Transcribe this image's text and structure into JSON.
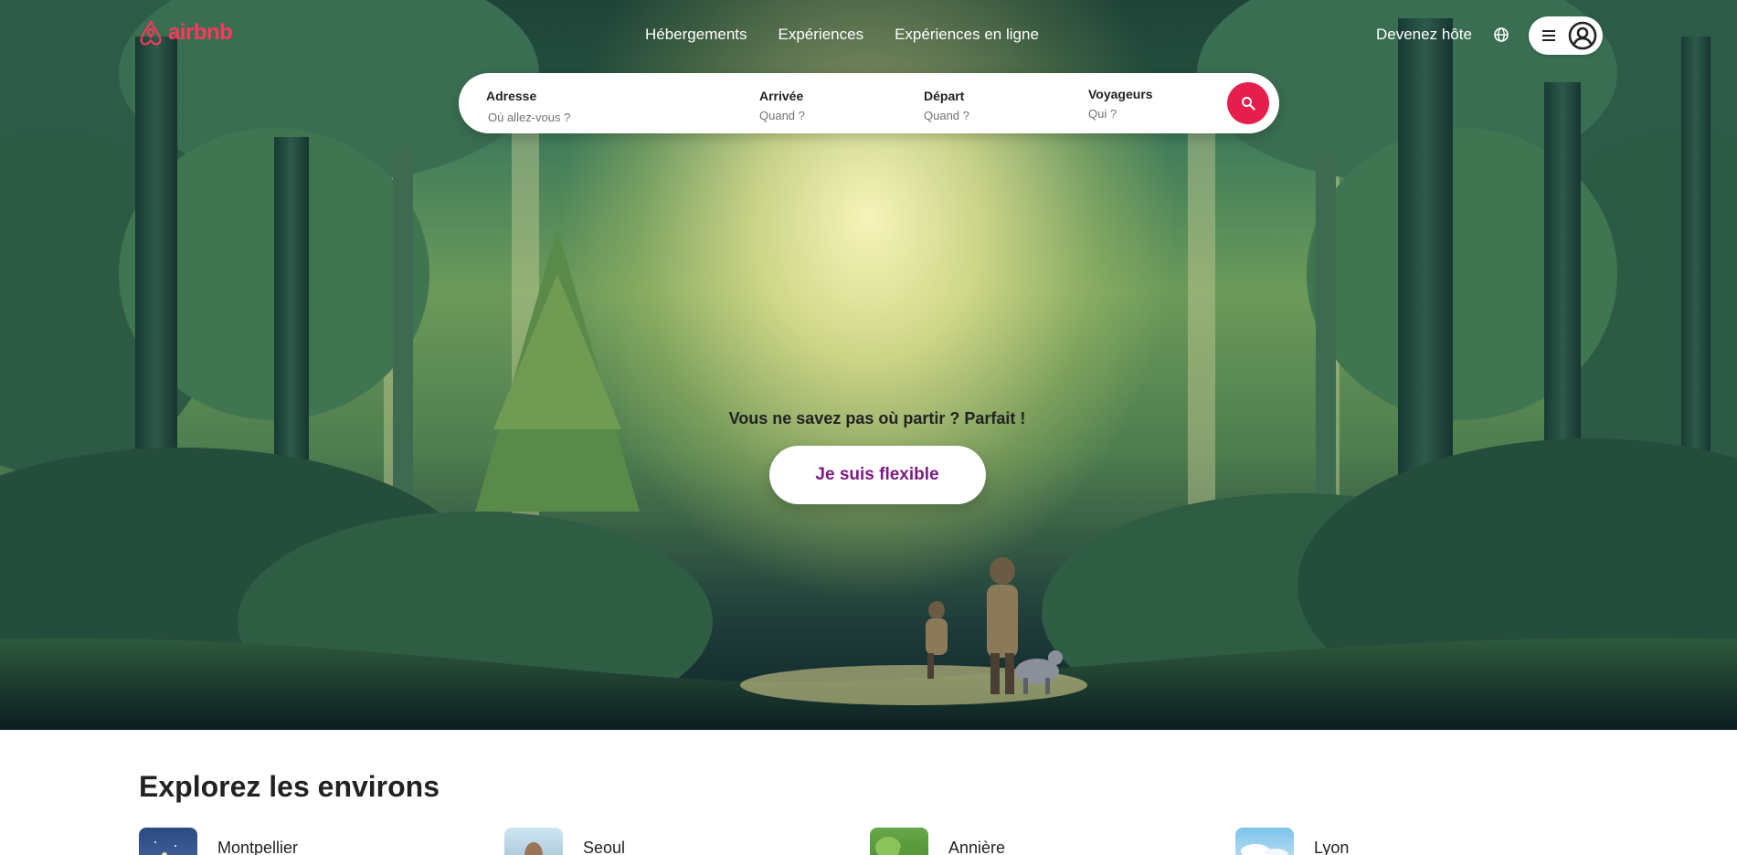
{
  "header": {
    "logo_text": "airbnb",
    "nav": [
      "Hébergements",
      "Expériences",
      "Expériences en ligne"
    ],
    "host_link": "Devenez hôte",
    "icons": {
      "logo": "airbnb-logo-icon",
      "globe": "globe-icon",
      "menu": "hamburger-menu-icon",
      "avatar": "user-avatar-icon"
    }
  },
  "search": {
    "fields": [
      {
        "label": "Adresse",
        "placeholder": "Où allez-vous ?"
      },
      {
        "label": "Arrivée",
        "placeholder": "Quand ?"
      },
      {
        "label": "Départ",
        "placeholder": "Quand ?"
      },
      {
        "label": "Voyageurs",
        "placeholder": "Qui ?"
      }
    ],
    "button_icon": "search-icon"
  },
  "hero": {
    "tagline": "Vous ne savez pas où partir ? Parfait !",
    "cta": "Je suis flexible"
  },
  "explore": {
    "title": "Explorez les environs",
    "places": [
      "Montpellier",
      "Seoul",
      "Annière",
      "Lyon"
    ]
  },
  "colors": {
    "brand": "#ff385c",
    "search_button": "#e61e4d",
    "cta_text": "#7b1c82"
  }
}
